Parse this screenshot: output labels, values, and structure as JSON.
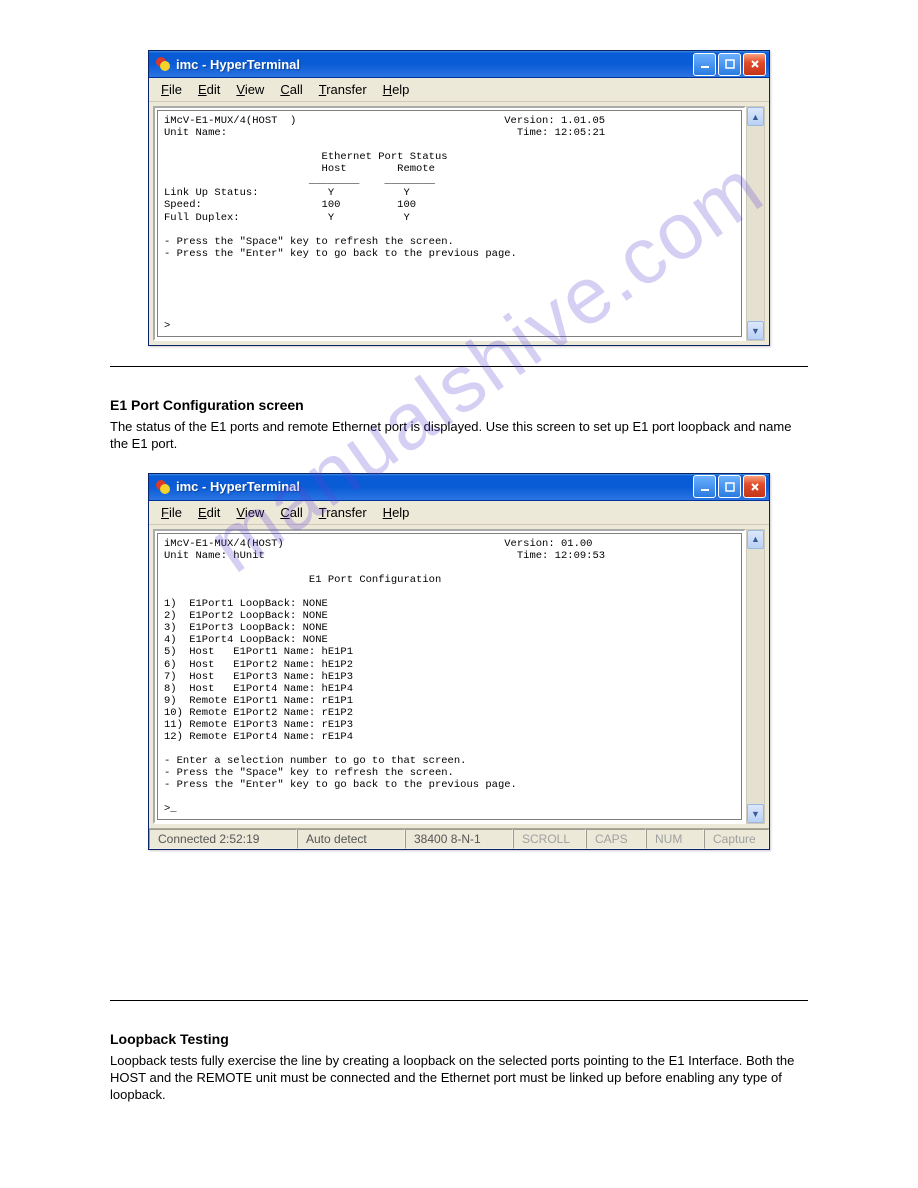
{
  "watermark": "manualshive.com",
  "section1": {
    "title": "E1 Port Configuration screen",
    "text": "The status of the E1 ports and remote Ethernet port is displayed. Use this screen to set up E1 port loopback and name the E1 port."
  },
  "section2": {
    "title": "Loopback Testing",
    "text": "Loopback tests fully exercise the line by creating a loopback on the selected ports pointing to the E1 Interface. Both the HOST and the REMOTE unit must be connected and the Ethernet port must be linked up before enabling any type of loopback."
  },
  "window1": {
    "title": "imc - HyperTerminal",
    "menu": {
      "file": "File",
      "edit": "Edit",
      "view": "View",
      "call": "Call",
      "transfer": "Transfer",
      "help": "Help"
    },
    "terminal": "iMcV-E1-MUX/4(HOST  )                                 Version: 1.01.05\nUnit Name:                                              Time: 12:05:21\n\n                         Ethernet Port Status\n                         Host        Remote\n                       ________    ________\nLink Up Status:           Y           Y\nSpeed:                   100         100\nFull Duplex:              Y           Y\n\n- Press the \"Space\" key to refresh the screen.\n- Press the \"Enter\" key to go back to the previous page.\n\n\n\n\n\n>"
  },
  "window2": {
    "title": "imc - HyperTerminal",
    "menu": {
      "file": "File",
      "edit": "Edit",
      "view": "View",
      "call": "Call",
      "transfer": "Transfer",
      "help": "Help"
    },
    "terminal": "iMcV-E1-MUX/4(HOST)                                   Version: 01.00\nUnit Name: hUnit                                        Time: 12:09:53\n\n                       E1 Port Configuration\n\n1)  E1Port1 LoopBack: NONE\n2)  E1Port2 LoopBack: NONE\n3)  E1Port3 LoopBack: NONE\n4)  E1Port4 LoopBack: NONE\n5)  Host   E1Port1 Name: hE1P1\n6)  Host   E1Port2 Name: hE1P2\n7)  Host   E1Port3 Name: hE1P3\n8)  Host   E1Port4 Name: hE1P4\n9)  Remote E1Port1 Name: rE1P1\n10) Remote E1Port2 Name: rE1P2\n11) Remote E1Port3 Name: rE1P3\n12) Remote E1Port4 Name: rE1P4\n\n- Enter a selection number to go to that screen.\n- Press the \"Space\" key to refresh the screen.\n- Press the \"Enter\" key to go back to the previous page.\n\n>_",
    "status": {
      "connected": "Connected 2:52:19",
      "autodetect": "Auto detect",
      "baud": "38400 8-N-1",
      "scroll": "SCROLL",
      "caps": "CAPS",
      "num": "NUM",
      "capture": "Capture"
    }
  }
}
